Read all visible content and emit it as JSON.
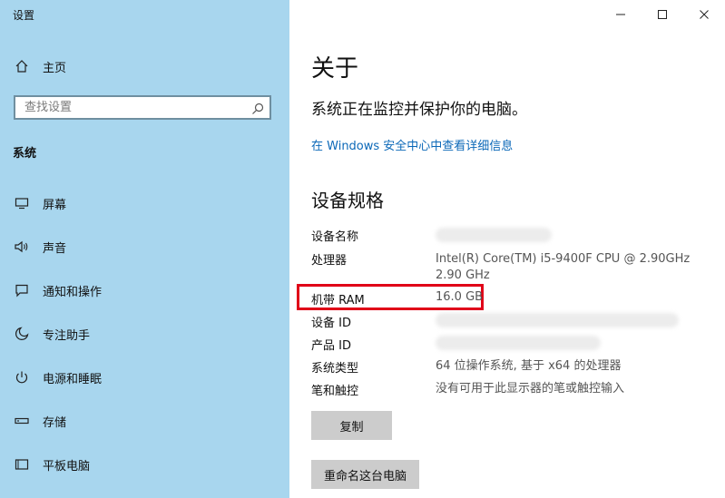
{
  "window": {
    "title": "设置",
    "minimize_icon": "minimize-icon",
    "maximize_icon": "maximize-icon",
    "close_icon": "close-icon"
  },
  "sidebar": {
    "home": {
      "label": "主页",
      "icon": "home-icon"
    },
    "search": {
      "placeholder": "查找设置",
      "icon": "search-icon"
    },
    "section": "系统",
    "items": [
      {
        "label": "屏幕",
        "icon": "display-icon"
      },
      {
        "label": "声音",
        "icon": "speaker-icon"
      },
      {
        "label": "通知和操作",
        "icon": "notification-icon"
      },
      {
        "label": "专注助手",
        "icon": "moon-icon"
      },
      {
        "label": "电源和睡眠",
        "icon": "power-icon"
      },
      {
        "label": "存储",
        "icon": "storage-icon"
      },
      {
        "label": "平板电脑",
        "icon": "tablet-icon"
      }
    ],
    "background_color": "#a8d6ee"
  },
  "main": {
    "title": "关于",
    "status": "系统正在监控并保护你的电脑。",
    "security_link": "在 Windows 安全中心中查看详细信息",
    "specs_title": "设备规格",
    "specs": [
      {
        "label": "设备名称",
        "value": ""
      },
      {
        "label": "处理器",
        "value": "Intel(R) Core(TM) i5-9400F CPU @ 2.90GHz",
        "value2": "2.90 GHz"
      },
      {
        "label": "机带 RAM",
        "value": "16.0 GB"
      },
      {
        "label": "设备 ID",
        "value": ""
      },
      {
        "label": "产品 ID",
        "value": ""
      },
      {
        "label": "系统类型",
        "value": "64 位操作系统, 基于 x64 的处理器"
      },
      {
        "label": "笔和触控",
        "value": "没有可用于此显示器的笔或触控输入"
      }
    ],
    "copy_button": "复制",
    "rename_button": "重命名这台电脑",
    "link_color": "#0b68b8",
    "highlight_color": "#e00018"
  }
}
